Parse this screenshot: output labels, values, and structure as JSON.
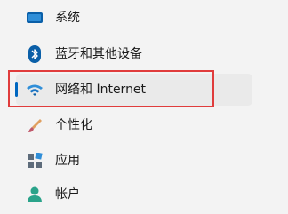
{
  "nav": {
    "items": [
      {
        "label": "系统",
        "icon": "display-icon",
        "selected": false
      },
      {
        "label": "蓝牙和其他设备",
        "icon": "bluetooth-icon",
        "selected": false
      },
      {
        "label": "网络和 Internet",
        "icon": "wifi-icon",
        "selected": true
      },
      {
        "label": "个性化",
        "icon": "brush-icon",
        "selected": false
      },
      {
        "label": "应用",
        "icon": "apps-icon",
        "selected": false
      },
      {
        "label": "帐户",
        "icon": "user-icon",
        "selected": false
      }
    ]
  },
  "colors": {
    "accent": "#0067c0",
    "highlight_box": "#e03c3c",
    "selected_bg": "#eaeaea",
    "background": "#f3f3f3"
  }
}
